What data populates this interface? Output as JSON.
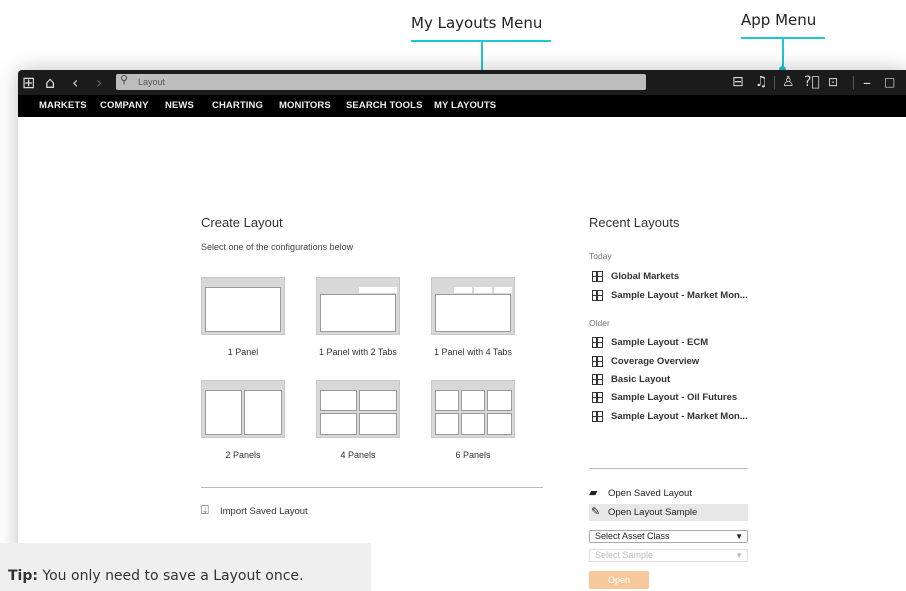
{
  "callouts": {
    "my_layouts": "My Layouts Menu",
    "app_menu": "App Menu"
  },
  "topbar": {
    "search_placeholder": "Layout",
    "icons": [
      "apps-grid-icon",
      "home-icon",
      "back-icon",
      "forward-icon",
      "search-icon",
      "layouts-icon",
      "bell-icon",
      "user-icon",
      "help-icon",
      "messages-icon",
      "minimize-icon",
      "maximize-icon"
    ]
  },
  "nav": {
    "items": [
      "MARKETS",
      "COMPANY",
      "NEWS",
      "CHARTING",
      "MONITORS",
      "SEARCH TOOLS",
      "MY LAYOUTS"
    ]
  },
  "create": {
    "title": "Create Layout",
    "subtitle": "Select one of the configurations below",
    "options": [
      "1 Panel",
      "1 Panel with 2 Tabs",
      "1 Panel with 4 Tabs",
      "2 Panels",
      "4 Panels",
      "6 Panels"
    ],
    "import_label": "Import Saved Layout"
  },
  "recent": {
    "title": "Recent Layouts",
    "today_label": "Today",
    "today": [
      "Global Markets",
      "Sample Layout - Market Mon..."
    ],
    "older_label": "Older",
    "older": [
      "Sample Layout - ECM",
      "Coverage Overview",
      "Basic Layout",
      "Sample Layout - Oil Futures",
      "Sample Layout - Market Mon..."
    ],
    "open_saved": "Open Saved Layout",
    "open_sample": "Open Layout Sample",
    "asset_class": "Select Asset Class",
    "sample": "Select Sample",
    "open_button": "Open"
  },
  "tip": {
    "label": "Tip:",
    "text": " You only need to save a Layout once."
  },
  "colors": {
    "accent": "#1ec6d6",
    "open_button": "#f6c89a",
    "nav_bg": "#000000"
  }
}
